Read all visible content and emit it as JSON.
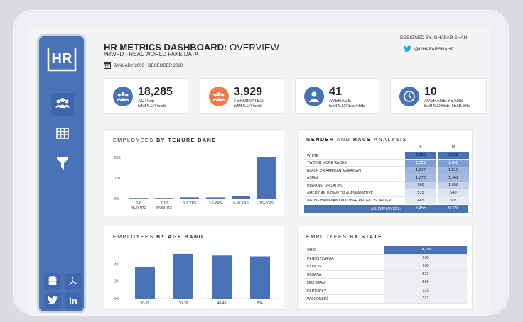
{
  "header": {
    "title_bold": "HR METRICS DASHBOARD:",
    "title_rest": "OVERVIEW",
    "subtitle": "#RWFD - REAL WORLD FAKE DATA",
    "date_range": "JANUARY 2000 - DECEMBER 2020",
    "designer": "DESIGNED BY: GHAFAR SHAH",
    "twitter": "@GHAFARSHAH9"
  },
  "sidebar": {
    "logo": "HR",
    "items": [
      {
        "icon": "users-icon",
        "active": true
      },
      {
        "icon": "table-icon",
        "active": false
      },
      {
        "icon": "filter-icon",
        "active": false
      }
    ],
    "links": [
      {
        "icon": "database-icon"
      },
      {
        "icon": "pdf-icon"
      },
      {
        "icon": "twitter-icon"
      },
      {
        "icon": "linkedin-icon",
        "label": "in"
      }
    ]
  },
  "kpis": [
    {
      "value": "18,285",
      "label1": "ACTIVE",
      "label2": "EMPLOYEES",
      "icon": "users-icon",
      "color": "#4a73b7"
    },
    {
      "value": "3,929",
      "label1": "TERMINATED",
      "label2": "EMPLOYEES",
      "icon": "users-icon",
      "color": "#f07c4a"
    },
    {
      "value": "41",
      "label1": "AVERAGE",
      "label2": "EMPLOYEE AGE",
      "icon": "person-icon",
      "color": "#4a73b7"
    },
    {
      "value": "10",
      "label1": "AVERAGE YEARS",
      "label2": "EMPLOYEE TENURE",
      "icon": "clock-icon",
      "color": "#4a73b7"
    }
  ],
  "panels": {
    "tenure": {
      "title_plain": "EMPLOYEES",
      "title_bold": "BY TENURE BAND"
    },
    "gender": {
      "title_bold1": "GENDER",
      "title_plain": "AND",
      "title_bold2": "RACE",
      "title_rest": "ANALYSIS"
    },
    "age": {
      "title_plain": "EMPLOYEES",
      "title_bold": "BY AGE BAND"
    },
    "state": {
      "title_plain": "EMPLOYEES",
      "title_bold": "BY STATE"
    }
  },
  "chart_data": [
    {
      "type": "bar",
      "title": "EMPLOYEES BY TENURE BAND",
      "categories": [
        "0-6 MONTHS",
        "7-12 MONTHS",
        "1-3 YRS",
        "3-5 YRS",
        "5-10 YRS",
        "10+ YRS"
      ],
      "category_lines": [
        [
          "0-6",
          "MONTHS"
        ],
        [
          "7-12",
          "MONTHS"
        ],
        [
          "1-3 YRS"
        ],
        [
          "3-5 YRS"
        ],
        [
          "5-10 YRS"
        ],
        [
          "10+ YRS"
        ]
      ],
      "values": [
        0,
        150,
        600,
        550,
        1100,
        20000
      ],
      "yticks": [
        "0K",
        "10K",
        "20K"
      ],
      "ylim": [
        0,
        21000
      ],
      "color": "#4a73b7"
    },
    {
      "type": "bar",
      "title": "EMPLOYEES BY AGE BAND",
      "categories": [
        "20-29",
        "30-39",
        "40-49",
        "50+"
      ],
      "values": [
        3700,
        5200,
        5000,
        4900
      ],
      "yticks": [
        "0K",
        "2K",
        "4K"
      ],
      "ylim": [
        0,
        5600
      ],
      "color": "#4a73b7"
    },
    {
      "type": "table",
      "title": "GENDER AND RACE ANALYSIS",
      "columns": [
        "F",
        "M"
      ],
      "rows": [
        {
          "label": "WHITE",
          "F": "2,399",
          "M": "2,629"
        },
        {
          "label": "TWO OR MORE RACES",
          "F": "1,329",
          "M": "1,546"
        },
        {
          "label": "BLACK OR AFRICAN AMERICAN",
          "F": "1,347",
          "M": "1,510"
        },
        {
          "label": "ASIAN",
          "F": "1,373",
          "M": "1,461"
        },
        {
          "label": "HISPANIC OR LATINO",
          "F": "960",
          "M": "1,036"
        },
        {
          "label": "AMERICAN INDIAN OR ALASKA NATIVE",
          "F": "515",
          "M": "540"
        },
        {
          "label": "NATIVE HAWAIIAN OR OTHER PACIFIC ISLANDER",
          "F": "445",
          "M": "507"
        }
      ],
      "total": {
        "label": "ALL EMPLOYEES:",
        "F": "8,455",
        "M": "9,328"
      },
      "shades": [
        "#4a73b7",
        "#7f9dd0",
        "#9db4dc",
        "#a6bbe0",
        "#c4d1ea",
        "#dde4f1",
        "#e7ecf4"
      ]
    },
    {
      "type": "table",
      "title": "EMPLOYEES BY STATE",
      "rows": [
        {
          "label": "OHIO",
          "value": "14,788"
        },
        {
          "label": "PENNSYLVANIA",
          "value": "930"
        },
        {
          "label": "ILLINOIS",
          "value": "730"
        },
        {
          "label": "INDIANA",
          "value": "572"
        },
        {
          "label": "MICHIGAN",
          "value": "569"
        },
        {
          "label": "KENTUCKY",
          "value": "375"
        },
        {
          "label": "WISCONSIN",
          "value": "321"
        }
      ]
    }
  ]
}
